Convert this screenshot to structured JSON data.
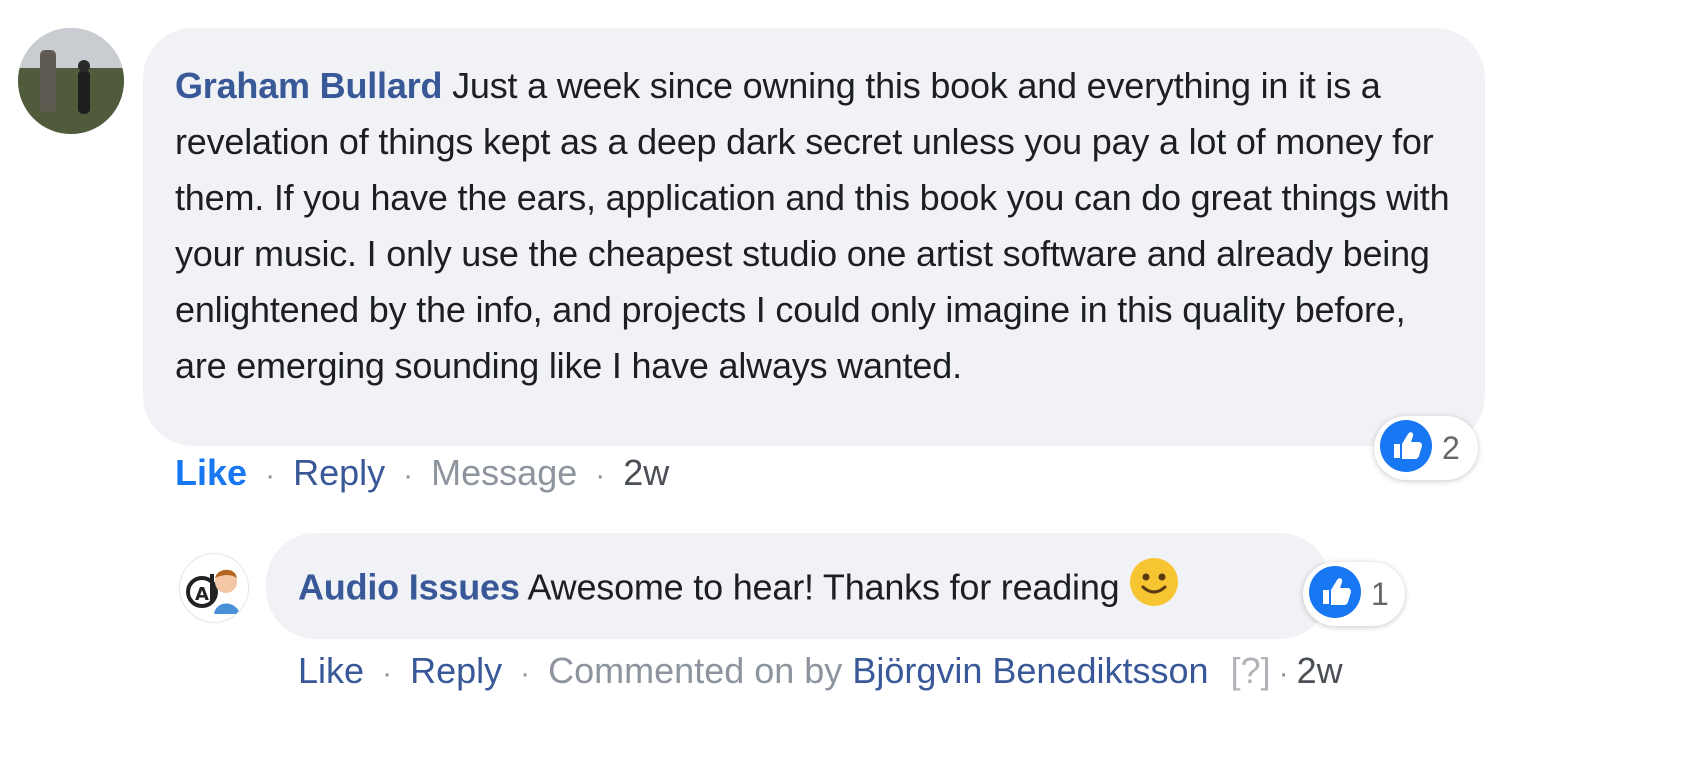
{
  "comment": {
    "author": "Graham Bullard",
    "text": "Just a week since owning this book and everything in it is a revelation of things kept as a deep dark secret unless you pay a lot of money for them. If you have the ears, application and this book you can do great things with your music. I only use the cheapest studio one artist software and already being enlightened by the info, and projects I could only imagine in this quality before, are emerging sounding like I have always wanted.",
    "actions": {
      "like": "Like",
      "reply": "Reply",
      "message": "Message",
      "time": "2w"
    },
    "reactions": {
      "icon": "thumbs-up-icon",
      "count": "2"
    }
  },
  "reply": {
    "author": "Audio Issues",
    "text": "Awesome to hear! Thanks for reading",
    "emoji": "slightly-smiling-face-emoji",
    "actions": {
      "like": "Like",
      "reply": "Reply",
      "commented_on_by": "Commented on by",
      "commenter": "Björgvin Benediktsson",
      "help": "[?]",
      "time": "2w"
    },
    "reactions": {
      "icon": "thumbs-up-icon",
      "count": "1"
    }
  },
  "colors": {
    "bubble": "#f0f2f5",
    "author_link": "#385898",
    "like_blue": "#1877f2",
    "meta_grey": "#8d949e"
  }
}
